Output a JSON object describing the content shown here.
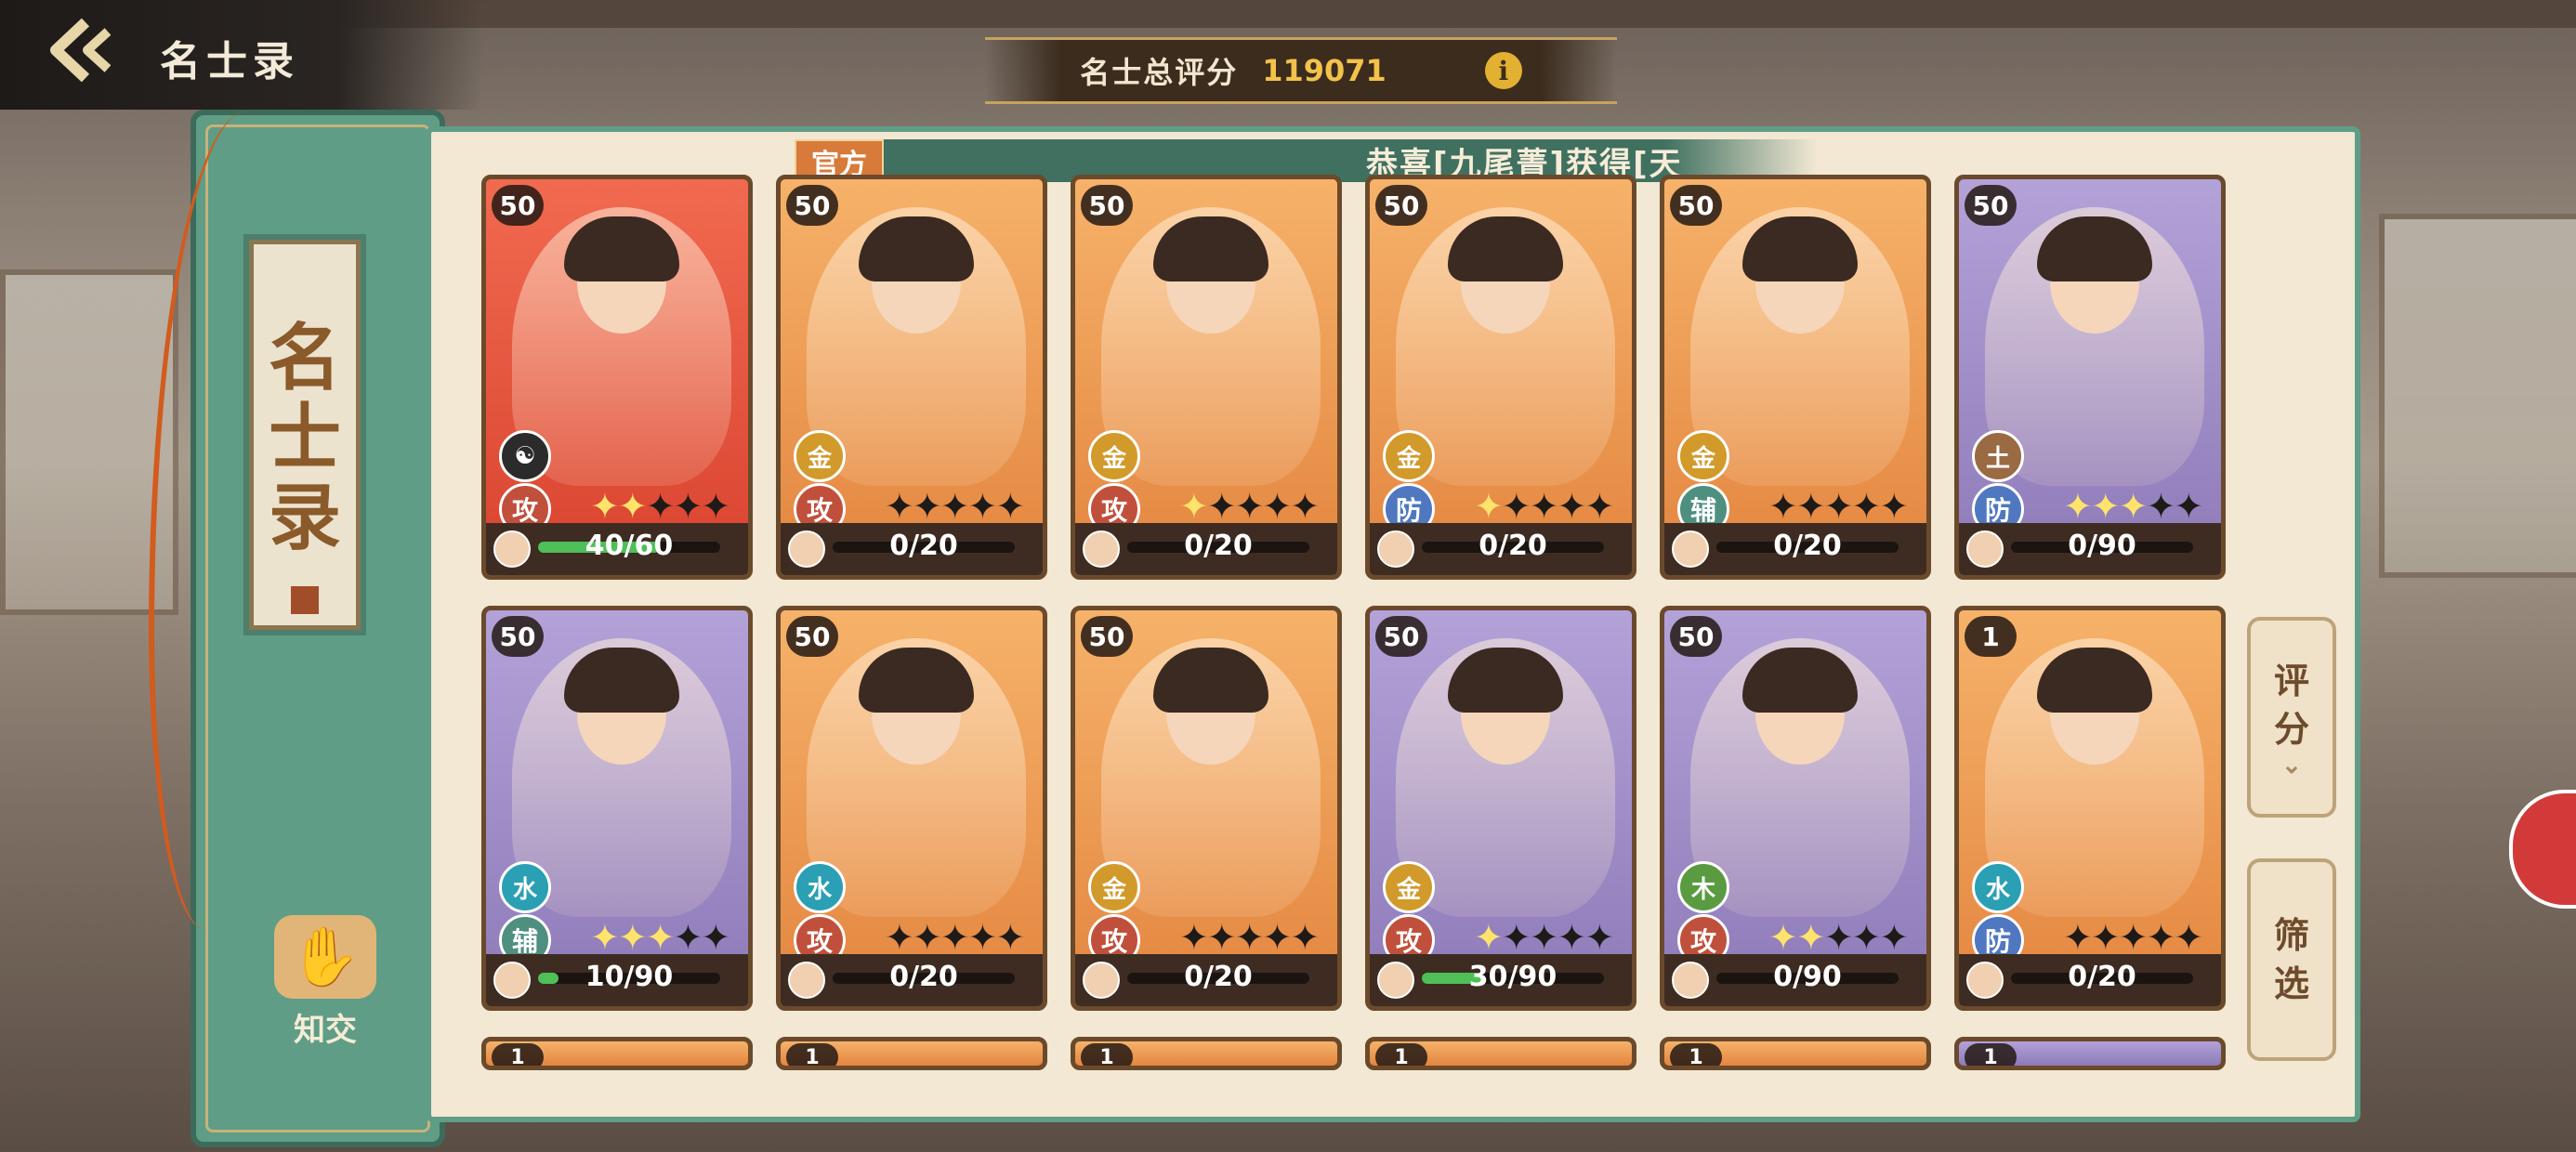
{
  "header": {
    "title": "名士录",
    "score_label": "名士总评分",
    "score_value": "119071",
    "info_icon": "i"
  },
  "left_tab": {
    "scroll_title": [
      "名",
      "士",
      "录"
    ],
    "friend_label": "知交",
    "friend_icon": "handshake-icon"
  },
  "marquee": {
    "tag": "官方",
    "text": "恭喜[九尾菁]获得[天"
  },
  "side_buttons": {
    "sort_label": [
      "评",
      "分"
    ],
    "filter_label": [
      "筛",
      "选"
    ]
  },
  "colors": {
    "jade": "#5f9d86",
    "gold": "#f2c24a",
    "parchment": "#f2e8d3"
  },
  "cards": [
    {
      "level": "50",
      "frame": "red",
      "element": "☯",
      "element_class": "el-yin",
      "role": "攻",
      "role_class": "role-atk",
      "stars": 2,
      "progress": "40/60",
      "fill": 0.67
    },
    {
      "level": "50",
      "frame": "orange",
      "element": "金",
      "element_class": "el-gold",
      "role": "攻",
      "role_class": "role-atk",
      "stars": 0,
      "progress": "0/20",
      "fill": 0
    },
    {
      "level": "50",
      "frame": "orange",
      "element": "金",
      "element_class": "el-gold",
      "role": "攻",
      "role_class": "role-atk",
      "stars": 1,
      "progress": "0/20",
      "fill": 0
    },
    {
      "level": "50",
      "frame": "orange",
      "element": "金",
      "element_class": "el-gold",
      "role": "防",
      "role_class": "role-def",
      "stars": 1,
      "progress": "0/20",
      "fill": 0
    },
    {
      "level": "50",
      "frame": "orange",
      "element": "金",
      "element_class": "el-gold",
      "role": "辅",
      "role_class": "role-sup",
      "stars": 0,
      "progress": "0/20",
      "fill": 0
    },
    {
      "level": "50",
      "frame": "purple",
      "element": "土",
      "element_class": "el-earth",
      "role": "防",
      "role_class": "role-def",
      "stars": 3,
      "progress": "0/90",
      "fill": 0
    },
    {
      "level": "50",
      "frame": "purple",
      "element": "水",
      "element_class": "el-water",
      "role": "辅",
      "role_class": "role-sup",
      "stars": 3,
      "progress": "10/90",
      "fill": 0.11
    },
    {
      "level": "50",
      "frame": "orange",
      "element": "水",
      "element_class": "el-water",
      "role": "攻",
      "role_class": "role-atk",
      "stars": 0,
      "progress": "0/20",
      "fill": 0
    },
    {
      "level": "50",
      "frame": "orange",
      "element": "金",
      "element_class": "el-gold",
      "role": "攻",
      "role_class": "role-atk",
      "stars": 0,
      "progress": "0/20",
      "fill": 0
    },
    {
      "level": "50",
      "frame": "purple",
      "element": "金",
      "element_class": "el-gold",
      "role": "攻",
      "role_class": "role-atk",
      "stars": 1,
      "progress": "30/90",
      "fill": 0.33
    },
    {
      "level": "50",
      "frame": "purple",
      "element": "木",
      "element_class": "el-wood",
      "role": "攻",
      "role_class": "role-atk",
      "stars": 2,
      "progress": "0/90",
      "fill": 0
    },
    {
      "level": "1",
      "frame": "orange",
      "element": "水",
      "element_class": "el-water",
      "role": "防",
      "role_class": "role-def",
      "stars": 0,
      "progress": "0/20",
      "fill": 0
    }
  ],
  "partial_row_levels": [
    "1",
    "1",
    "1",
    "1",
    "1",
    "1"
  ]
}
